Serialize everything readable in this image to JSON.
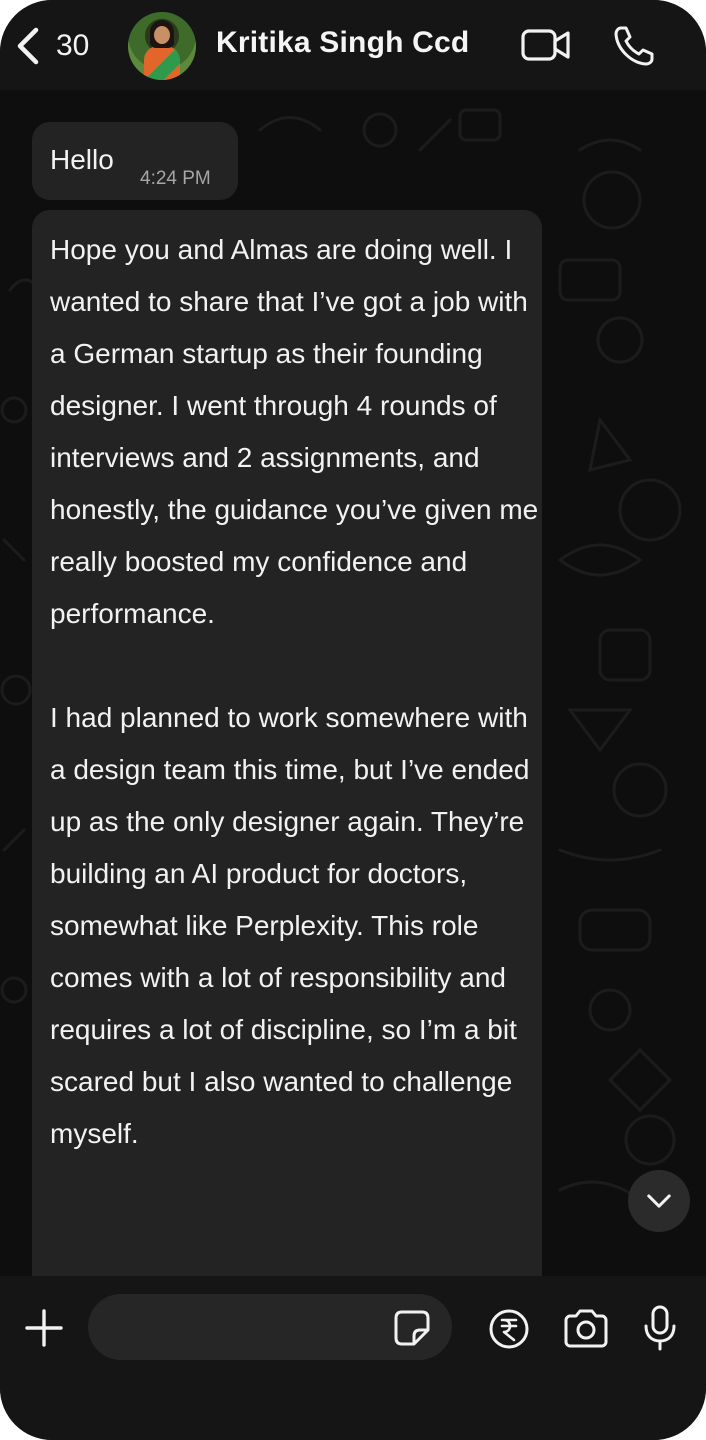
{
  "header": {
    "back_count": "30",
    "contact_name": "Kritika Singh Ccd"
  },
  "messages": [
    {
      "text": "Hello",
      "time": "4:24 PM"
    },
    {
      "text": "Hope you and Almas are doing well. I wanted to share that I’ve got a job with a German startup as their founding designer. I went through 4 rounds of interviews and 2 assignments, and honestly, the guidance you’ve given me really boosted my confidence and performance.\n\nI had planned to work somewhere with a design team this time, but I’ve ended up as the only designer again. They’re building an AI product for doctors, somewhat like Perplexity. This role comes with a lot of responsibility and requires a lot of discipline, so I’m a bit scared but I also wanted to challenge myself."
    }
  ],
  "composer": {
    "placeholder": ""
  },
  "icons": {
    "back": "chevron-left-icon",
    "video": "video-camera-icon",
    "call": "phone-icon",
    "plus": "plus-icon",
    "sticker": "sticker-icon",
    "payment": "rupee-icon",
    "camera": "camera-icon",
    "mic": "microphone-icon",
    "scroll": "chevron-down-icon"
  },
  "colors": {
    "background": "#0b0b0b",
    "bubble": "#232323",
    "text": "#f2f2f2",
    "timestamp": "#a6a6a6"
  }
}
